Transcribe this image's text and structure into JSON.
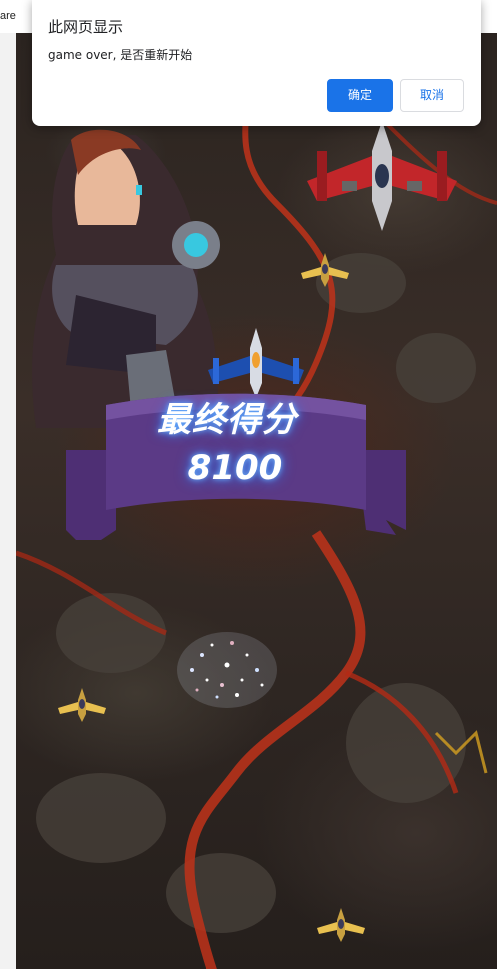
{
  "browser": {
    "tab_fragment": "are"
  },
  "dialog": {
    "title": "此网页显示",
    "message": "game over, 是否重新开始",
    "ok_label": "确定",
    "cancel_label": "取消"
  },
  "game": {
    "final_score_label": "最终得分",
    "final_score": "8100"
  },
  "colors": {
    "primary_button": "#1a73e8",
    "banner": "#5b3a86",
    "lava": "#c0321a",
    "score_glow": "#2a7bff"
  }
}
